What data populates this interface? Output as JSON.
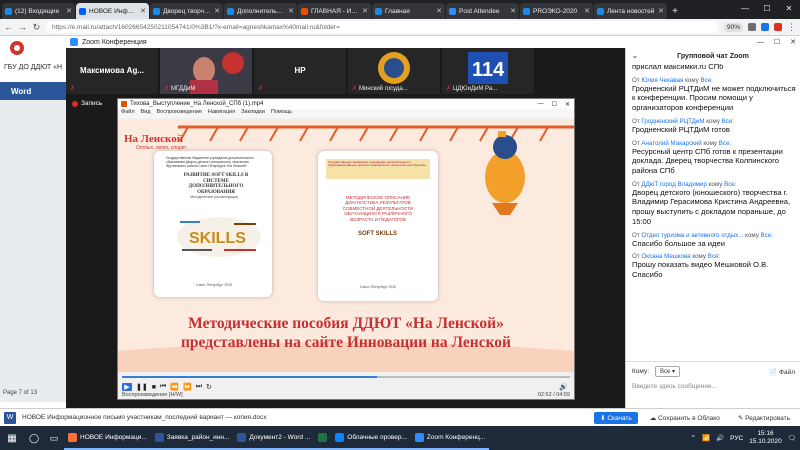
{
  "browser": {
    "tabs": [
      {
        "label": "(12) Входящие",
        "color": "#1e88e5",
        "active": false
      },
      {
        "label": "НОВОЕ Информационное",
        "color": "#005ff9",
        "active": true
      },
      {
        "label": "Дворец творчества",
        "color": "#1e88e5",
        "active": false
      },
      {
        "label": "Дополнительное",
        "color": "#1e88e5",
        "active": false
      },
      {
        "label": "ГЛАВНАЯ - Инновации",
        "color": "#e65100",
        "active": false
      },
      {
        "label": "Главная",
        "color": "#1e88e5",
        "active": false
      },
      {
        "label": "Post Attendee",
        "color": "#2d8cff",
        "active": false
      },
      {
        "label": "PROЭКО-2020",
        "color": "#1e88e5",
        "active": false
      },
      {
        "label": "Лента новостей",
        "color": "#1e88e5",
        "active": false
      }
    ],
    "new_tab": "+",
    "url": "https://e.mail.ru/attach/16026654250211054741/0%3B1/?x-email=agneshkamax%40mail.ru&folder=",
    "zoom_level": "90%"
  },
  "background_page": {
    "org_text": "ГБУ ДО ДДЮТ «Н",
    "word_header": "Word",
    "page_indicator": "Page 7 of 13"
  },
  "zoom": {
    "window_title": "Zoom Конференция",
    "participants": [
      {
        "name": "Максимова Ag...",
        "caption": "",
        "type": "name"
      },
      {
        "name": "",
        "caption": "МГДДиМ",
        "type": "video"
      },
      {
        "name": "HP",
        "caption": "",
        "type": "name"
      },
      {
        "name": "",
        "caption": "Минский госуда...",
        "type": "logo"
      },
      {
        "name": "",
        "caption": "ЦДЮиДиМ Ра...",
        "type": "logo114"
      }
    ],
    "next_arrow": "›",
    "record_label": "Запись",
    "chat_title": "Групповой чат Zoom",
    "chat_messages": [
      {
        "sender": "",
        "to": "",
        "body": "прислал максимки.ru СПб",
        "partial": true
      },
      {
        "sender": "Юлия Чекавая",
        "to": "Все:",
        "body": "Гродненский РЦТДиМ не может подключиться к конференции. Просим помощи у организаторов конференции"
      },
      {
        "sender": "Гродненский РЦТДиМ",
        "to": "Все:",
        "body": "Гродненский РЦТДиМ готов"
      },
      {
        "sender": "Анатолий Макарский",
        "to": "Все:",
        "body": "Ресурсный центр СПб готов к презентации доклада. Дверец творчества Колпинского района СПб"
      },
      {
        "sender": "ДДюТ город Владимир",
        "to": "Все:",
        "body": "Дворец детского (юношеского) творчества г. Владимир Герасимова Кристина Андреевна, прошу выступить с докладом пораньше, до 15:00"
      },
      {
        "sender": "Отдел туризма и активного отдых...",
        "to": "Все:",
        "body": "Спасибо большое за идеи"
      },
      {
        "sender": "Оксана Мешкова",
        "to": "Все:",
        "body": "Прошу показать видео Мешковой О.В. Спасибо"
      }
    ],
    "chat_from_prefix": "От",
    "chat_to_word": "кому",
    "chat_to_label": "Кому:",
    "chat_to_value": "Все",
    "chat_file": "Файл",
    "chat_placeholder": "Введите здесь сообщение..."
  },
  "player": {
    "title": "Тихова_Выступление_На Ленской_СПб (1).mp4",
    "menu": [
      "Файл",
      "Вид",
      "Воспроизведение",
      "Навигация",
      "Закладки",
      "Помощь"
    ],
    "progress": 0.57,
    "status_left": "Воспроизведение [H/W]",
    "status_right": "02:52 / 04:59"
  },
  "slide": {
    "logo_title": "На Ленской",
    "logo_sub": "Отдых, лето, спорт",
    "book1": {
      "header": "Государственное бюджетное учреждение дополнительного образования Дворец детского (юношеского) творчества Фрунзенского района Санкт-Петербурга «На Ленской»",
      "title": "РАЗВИТИЕ SOFT SKILLS В СИСТЕМЕ ДОПОЛНИТЕЛЬНОГО ОБРАЗОВАНИЯ",
      "subtitle": "Методические рекомендации",
      "cloud": "SKILLS",
      "footer": "Санкт-Петербург 2019"
    },
    "book2": {
      "header": "Государственное бюджетное учреждение дополнительного образования Дворец детского (юношеского) творчества «На Ленской»",
      "body": "МЕТОДИЧЕСКОЕ ОПИСАНИЕ ДИАГНОСТИКА РЕЗУЛЬТАТОВ СОВМЕСТНОЙ ДЕЯТЕЛЬНОСТИ ОБУЧАЮЩИХСЯ РАЗЛИЧНОГО ВОЗРАСТА И ПЕДАГОГОВ",
      "skills": "SOFT SKILLS",
      "footer": "Санкт-Петербург 2020"
    },
    "caption_line1": "Методические пособия ДДЮТ «На Ленской»",
    "caption_line2": "представлены на сайте Инновации на Ленской"
  },
  "downloads": {
    "filename": "НОВОЕ Информационное письмо участникам_последний вариант — копия.docx",
    "download": "Скачать",
    "save_cloud": "Сохранить в Облако",
    "edit": "Редактировать"
  },
  "taskbar": {
    "apps": [
      {
        "label": "НОВОЕ Информаци...",
        "color": "#ff7139"
      },
      {
        "label": "Заявка_район_инн...",
        "color": "#2b579a"
      },
      {
        "label": "Документ2 - Word ...",
        "color": "#2b579a"
      },
      {
        "label": "",
        "color": "#217346"
      },
      {
        "label": "Облачные провер...",
        "color": "#0a84ff"
      },
      {
        "label": "Zoom Конференц...",
        "color": "#2d8cff"
      }
    ],
    "language": "РУС",
    "time": "15:16",
    "date": "15.10.2020"
  }
}
